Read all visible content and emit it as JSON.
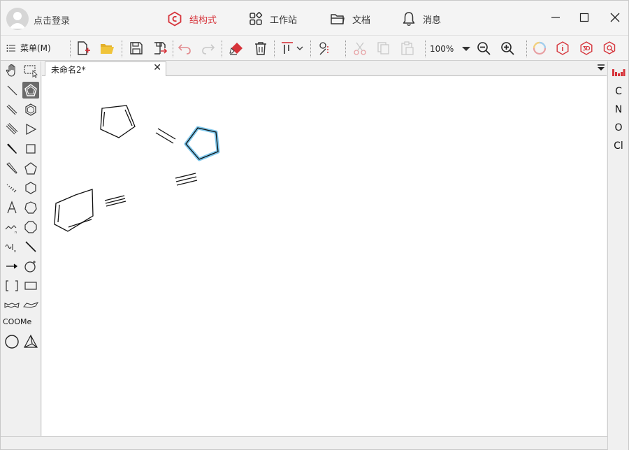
{
  "header": {
    "login_label": "点击登录",
    "tabs": [
      {
        "label": "结构式",
        "active": true
      },
      {
        "label": "工作站",
        "active": false
      },
      {
        "label": "文档",
        "active": false
      },
      {
        "label": "消息",
        "active": false
      }
    ]
  },
  "toolbar": {
    "menu_label": "菜单(M)",
    "zoom": "100%"
  },
  "left_palette": {
    "coome_label": "COOMe"
  },
  "document": {
    "tab_label": "未命名2*"
  },
  "elements": [
    "C",
    "N",
    "O",
    "Cl"
  ],
  "colors": {
    "accent": "#d6333a",
    "selection": "#5bb8e6",
    "background": "#f0f0f0"
  }
}
